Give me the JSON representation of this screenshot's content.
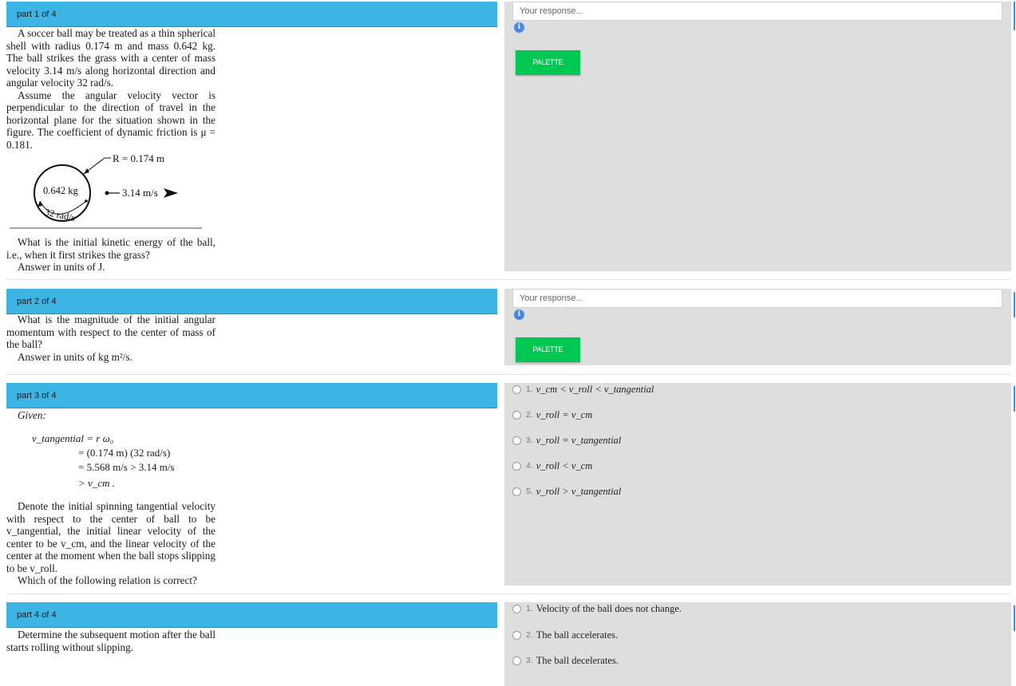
{
  "parts": [
    {
      "header": "part 1 of 4",
      "paragraph1": "A soccer ball may be treated as a thin spherical shell with radius 0.174 m and mass 0.642 kg. The ball strikes the grass with a center of mass velocity 3.14 m/s along horizontal direction and angular velocity 32 rad/s.",
      "paragraph2": "Assume the angular velocity vector is perpendicular to the direction of travel in the horizontal plane for the situation shown in the figure. The coefficient of dynamic friction is μ = 0.181.",
      "figure": {
        "radius_label": "R = 0.174 m",
        "mass_label": "0.642 kg",
        "velocity_label": "3.14 m/s",
        "angular_label": "32 rad/s"
      },
      "question": "What is the initial kinetic energy of the ball, i.e., when it first strikes the grass?",
      "units": "Answer in units of  J.",
      "response_placeholder": "Your response...",
      "palette_label": "PALETTE",
      "info_icon": "i"
    },
    {
      "header": "part 2 of 4",
      "question": "What is the magnitude of the initial angular momentum with respect to the center of mass of the ball?",
      "units": "Answer in units of  kg m²/s.",
      "response_placeholder": "Your response...",
      "palette_label": "PALETTE",
      "info_icon": "i"
    },
    {
      "header": "part 3 of 4",
      "given": "Given:",
      "equations": [
        "v_tangential = r ω₀",
        "= (0.174 m) (32 rad/s)",
        "= 5.568 m/s > 3.14 m/s",
        "> v_cm ."
      ],
      "paragraph": "Denote the initial spinning tangential velocity with respect to the center of ball to be v_tangential, the initial linear velocity of the center to be v_cm, and the linear velocity of the center at the moment when the ball stops slipping to be v_roll.",
      "question": "Which of the following relation is correct?",
      "options": [
        {
          "num": "1.",
          "text": "v_cm < v_roll < v_tangential"
        },
        {
          "num": "2.",
          "text": "v_roll = v_cm"
        },
        {
          "num": "3.",
          "text": "v_roll = v_tangential"
        },
        {
          "num": "4.",
          "text": "v_roll < v_cm"
        },
        {
          "num": "5.",
          "text": "v_roll > v_tangential"
        }
      ]
    },
    {
      "header": "part 4 of 4",
      "question": "Determine the subsequent motion after the ball starts rolling without slipping.",
      "options": [
        {
          "num": "1.",
          "text": "Velocity of the ball does not change."
        },
        {
          "num": "2.",
          "text": "The ball accelerates."
        },
        {
          "num": "3.",
          "text": "The ball decelerates."
        }
      ]
    }
  ],
  "colors": {
    "header_bg": "#3cb5e5",
    "panel_bg": "#dedede",
    "palette_bg": "#00c853",
    "info_bg": "#4a88e0"
  }
}
